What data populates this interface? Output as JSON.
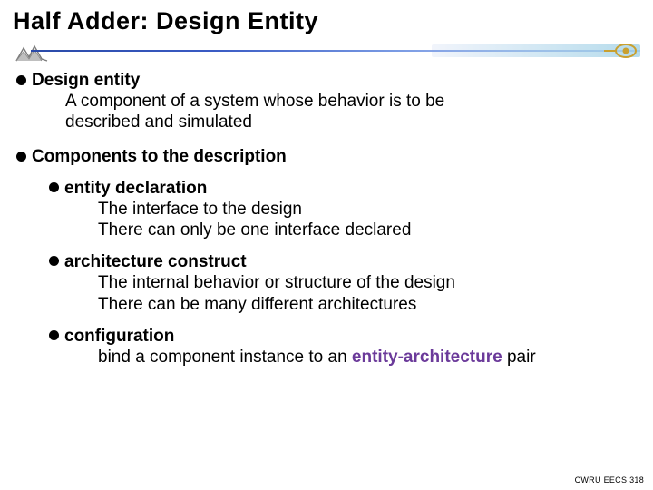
{
  "title": "Half Adder:  Design Entity",
  "section1": {
    "heading": "Design entity",
    "line1": "A component of a system whose behavior is to be",
    "line2": "described and simulated"
  },
  "section2": {
    "heading": "Components to the description",
    "item1": {
      "heading": "entity declaration",
      "line1": "The interface to the design",
      "line2": "There can only be one interface declared"
    },
    "item2": {
      "heading": "architecture construct",
      "line1": "The internal behavior or structure of the design",
      "line2": "There can be many different architectures"
    },
    "item3": {
      "heading": "configuration",
      "line1a": " bind a component instance to an ",
      "line1b": "entity-architecture",
      "line1c": " pair"
    }
  },
  "footer": "CWRU EECS 318"
}
